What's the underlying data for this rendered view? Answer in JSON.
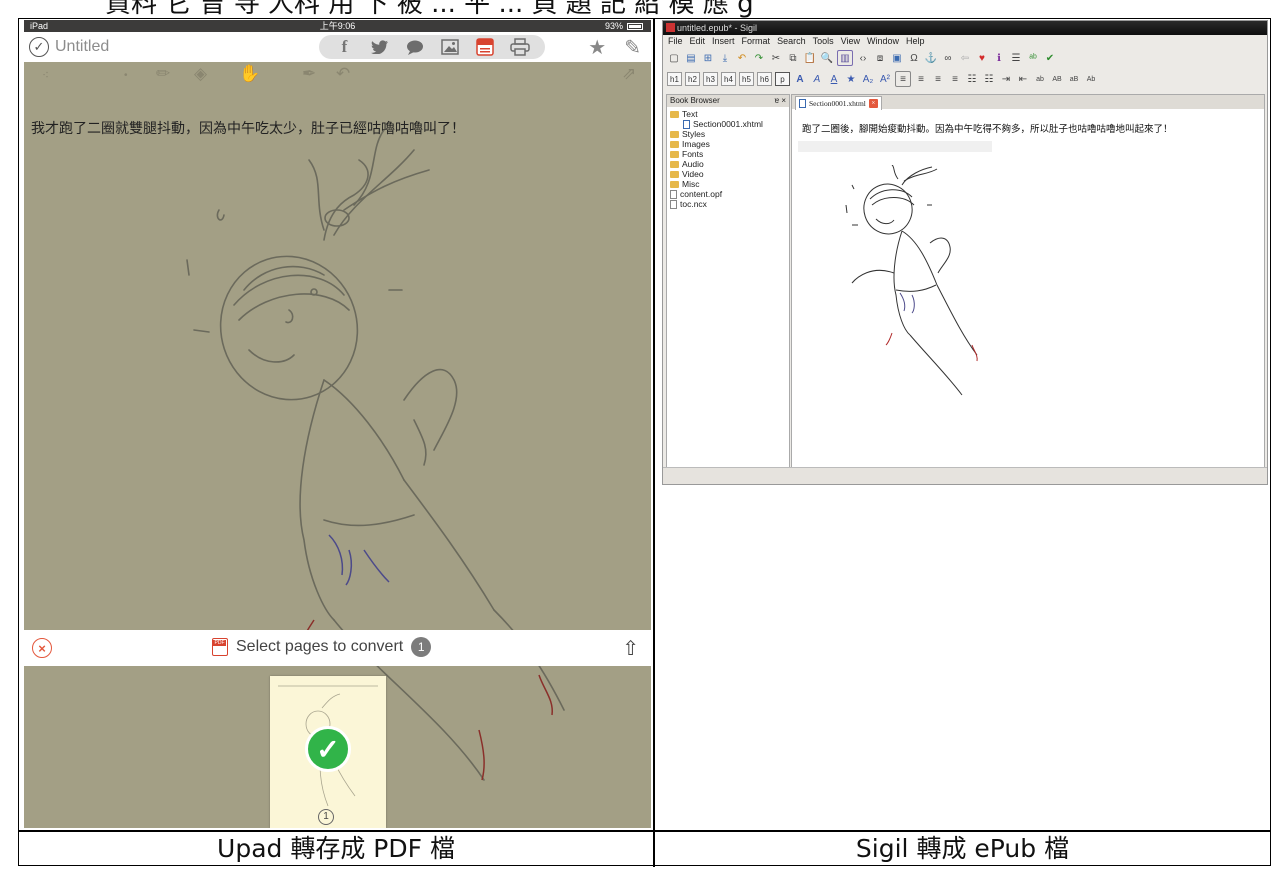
{
  "cut_header": "資料 它 曾 寻 人科 用 下 被 ... 平 ... 頁 題 記 紹 模 應 g",
  "captions": {
    "left": "Upad 轉存成 PDF 檔",
    "right": "Sigil 轉成 ePub 檔"
  },
  "upad": {
    "status": {
      "device": "iPad",
      "time": "上午9:06",
      "battery": "93%"
    },
    "title": "Untitled",
    "share_icons": [
      "facebook-icon",
      "twitter-icon",
      "message-icon",
      "image-icon",
      "pdf-icon",
      "print-icon"
    ],
    "page_text": "我才跑了二圈就雙腿抖動，因為中午吃太少，肚子已經咕嚕咕嚕叫了！",
    "convert_label": "Select pages to convert",
    "selected_count": "1",
    "thumb_page": "1"
  },
  "sigil": {
    "window_title": "untitled.epub* - Sigil",
    "menu": [
      "File",
      "Edit",
      "Insert",
      "Format",
      "Search",
      "Tools",
      "View",
      "Window",
      "Help"
    ],
    "heading_buttons": [
      "h1",
      "h2",
      "h3",
      "h4",
      "h5",
      "h6",
      "p"
    ],
    "book_browser_title": "Book Browser",
    "tree": [
      {
        "label": "Text",
        "type": "folder",
        "indent": 0
      },
      {
        "label": "Section0001.xhtml",
        "type": "file",
        "indent": 1
      },
      {
        "label": "Styles",
        "type": "folder",
        "indent": 0
      },
      {
        "label": "Images",
        "type": "folder",
        "indent": 0
      },
      {
        "label": "Fonts",
        "type": "folder",
        "indent": 0
      },
      {
        "label": "Audio",
        "type": "folder",
        "indent": 0
      },
      {
        "label": "Video",
        "type": "folder",
        "indent": 0
      },
      {
        "label": "Misc",
        "type": "folder",
        "indent": 0
      },
      {
        "label": "content.opf",
        "type": "file",
        "indent": 0
      },
      {
        "label": "toc.ncx",
        "type": "file",
        "indent": 0
      }
    ],
    "tab_label": "Section0001.xhtml",
    "editor_text": "跑了二圈後，腳開始痠動抖動。因為中午吃得不夠多，所以肚子也咕嚕咕嚕地叫起來了！"
  }
}
